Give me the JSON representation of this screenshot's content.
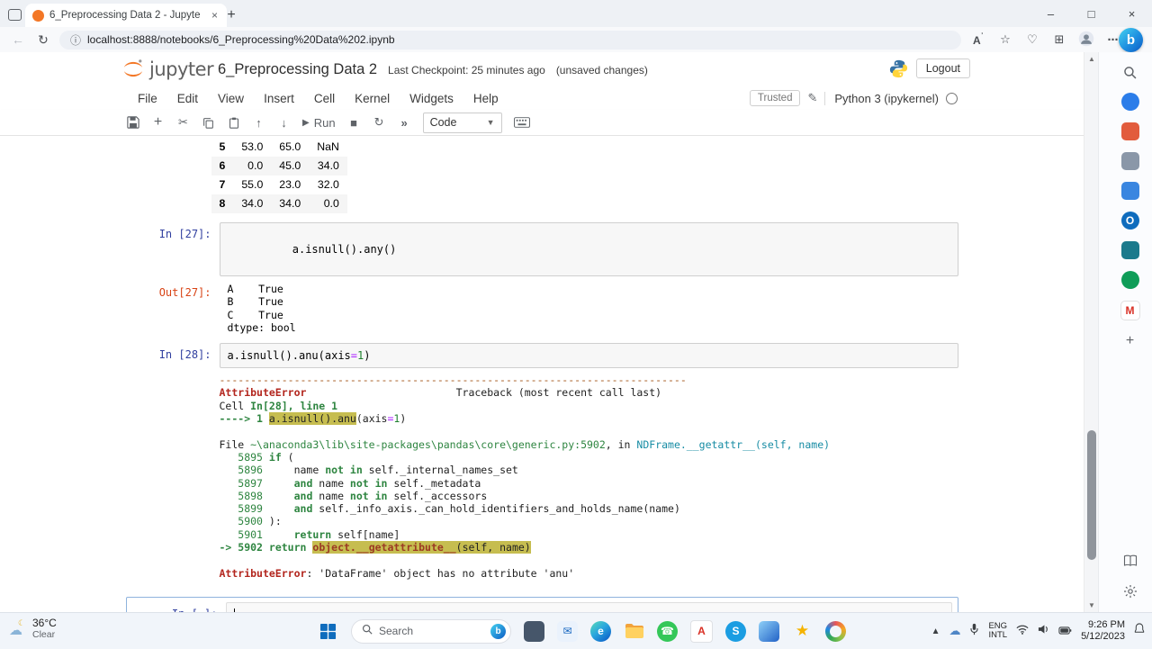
{
  "browser": {
    "tab_title": "6_Preprocessing Data 2 - Jupyte",
    "url": "localhost:8888/notebooks/6_Preprocessing%20Data%202.ipynb"
  },
  "jupyter": {
    "brand": "jupyter",
    "title": "6_Preprocessing Data 2",
    "checkpoint": "Last Checkpoint: 25 minutes ago",
    "unsaved": "(unsaved changes)",
    "logout_label": "Logout",
    "menu": [
      "File",
      "Edit",
      "View",
      "Insert",
      "Cell",
      "Kernel",
      "Widgets",
      "Help"
    ],
    "trusted_label": "Trusted",
    "kernel_label": "Python 3 (ipykernel)",
    "run_label": "Run",
    "cell_type_value": "Code",
    "brand_color": "#f37726"
  },
  "notebook": {
    "partial_table": {
      "rows": [
        {
          "index": "5",
          "values": [
            "53.0",
            "65.0",
            "NaN"
          ]
        },
        {
          "index": "6",
          "values": [
            "0.0",
            "45.0",
            "34.0"
          ]
        },
        {
          "index": "7",
          "values": [
            "55.0",
            "23.0",
            "32.0"
          ]
        },
        {
          "index": "8",
          "values": [
            "34.0",
            "34.0",
            "0.0"
          ]
        }
      ]
    },
    "in27": {
      "prompt": "In [27]:",
      "source": "a.isnull().any()"
    },
    "out27": {
      "prompt": "Out[27]:",
      "text": "A    True\nB    True\nC    True\ndtype: bool"
    },
    "in28": {
      "prompt": "In [28]:",
      "source_segments": [
        {
          "t": "a.isnull().anu(axis",
          "c": "plain"
        },
        {
          "t": "=",
          "c": "op"
        },
        {
          "t": "1",
          "c": "num"
        },
        {
          "t": ")",
          "c": "plain"
        }
      ]
    },
    "empty_cell": {
      "prompt": "In [ ]:"
    },
    "traceback": {
      "lines": [
        [
          {
            "t": "---------------------------------------------------------------------------",
            "c": "sep"
          }
        ],
        [
          {
            "t": "AttributeError",
            "c": "redb"
          },
          {
            "t": "                        Traceback (most recent call last)",
            "c": "plain"
          }
        ],
        [
          {
            "t": "Cell ",
            "c": "plain"
          },
          {
            "t": "In[28], line 1",
            "c": "greenb"
          }
        ],
        [
          {
            "t": "----> 1",
            "c": "greenb"
          },
          {
            "t": " ",
            "c": "plain"
          },
          {
            "t": "a.isnull().anu",
            "c": "hl"
          },
          {
            "t": "(axis",
            "c": "plain"
          },
          {
            "t": "=",
            "c": "op"
          },
          {
            "t": "1",
            "c": "num"
          },
          {
            "t": ")",
            "c": "plain"
          }
        ],
        [],
        [
          {
            "t": "File ",
            "c": "plain"
          },
          {
            "t": "~\\anaconda3\\lib\\site-packages\\pandas\\core\\generic.py:5902",
            "c": "green"
          },
          {
            "t": ", in ",
            "c": "plain"
          },
          {
            "t": "NDFrame.__getattr__",
            "c": "cyan"
          },
          {
            "t": "(self, name)",
            "c": "cyan"
          }
        ],
        [
          {
            "t": "   5895 ",
            "c": "green"
          },
          {
            "t": "if",
            "c": "greenb"
          },
          {
            "t": " (",
            "c": "plain"
          }
        ],
        [
          {
            "t": "   5896 ",
            "c": "green"
          },
          {
            "t": "    name ",
            "c": "plain"
          },
          {
            "t": "not in",
            "c": "greenb"
          },
          {
            "t": " self._internal_names_set",
            "c": "plain"
          }
        ],
        [
          {
            "t": "   5897 ",
            "c": "green"
          },
          {
            "t": "    ",
            "c": "plain"
          },
          {
            "t": "and",
            "c": "greenb"
          },
          {
            "t": " name ",
            "c": "plain"
          },
          {
            "t": "not in",
            "c": "greenb"
          },
          {
            "t": " self._metadata",
            "c": "plain"
          }
        ],
        [
          {
            "t": "   5898 ",
            "c": "green"
          },
          {
            "t": "    ",
            "c": "plain"
          },
          {
            "t": "and",
            "c": "greenb"
          },
          {
            "t": " name ",
            "c": "plain"
          },
          {
            "t": "not in",
            "c": "greenb"
          },
          {
            "t": " self._accessors",
            "c": "plain"
          }
        ],
        [
          {
            "t": "   5899 ",
            "c": "green"
          },
          {
            "t": "    ",
            "c": "plain"
          },
          {
            "t": "and",
            "c": "greenb"
          },
          {
            "t": " self._info_axis._can_hold_identifiers_and_holds_name(name)",
            "c": "plain"
          }
        ],
        [
          {
            "t": "   5900 ",
            "c": "green"
          },
          {
            "t": "):",
            "c": "plain"
          }
        ],
        [
          {
            "t": "   5901 ",
            "c": "green"
          },
          {
            "t": "    ",
            "c": "plain"
          },
          {
            "t": "return",
            "c": "greenb"
          },
          {
            "t": " self[name]",
            "c": "plain"
          }
        ],
        [
          {
            "t": "-> 5902",
            "c": "greenb"
          },
          {
            "t": " ",
            "c": "plain"
          },
          {
            "t": "return",
            "c": "greenb"
          },
          {
            "t": " ",
            "c": "plain"
          },
          {
            "t": "object.__getattribute__",
            "c": "hlred"
          },
          {
            "t": "(self, name)",
            "c": "hl"
          }
        ],
        [],
        [
          {
            "t": "AttributeError",
            "c": "redb"
          },
          {
            "t": ": 'DataFrame' object has no attribute 'anu'",
            "c": "plain"
          }
        ]
      ]
    }
  },
  "edge_sidebar": {
    "icons": [
      {
        "name": "sidebar-search-icon",
        "svg": "search",
        "plain": true
      },
      {
        "name": "sidebar-copilot-icon",
        "bg": "#2b7de9",
        "round": true
      },
      {
        "name": "sidebar-shopping-icon",
        "bg": "#e25c3d"
      },
      {
        "name": "sidebar-games-icon",
        "bg": "#8a97a8"
      },
      {
        "name": "sidebar-tools-icon",
        "bg": "#3a86e0"
      },
      {
        "name": "sidebar-outlook-icon",
        "bg": "#0f6cbd",
        "glyph": "O",
        "round": true
      },
      {
        "name": "sidebar-office-icon",
        "bg": "#1b7a8c"
      },
      {
        "name": "sidebar-planner-icon",
        "bg": "#0f9d58",
        "round": true
      },
      {
        "name": "sidebar-mail-m-icon",
        "bg": "#ffffff",
        "glyph": "M",
        "fg": "#d93025",
        "border": "1px solid #e0e0e0"
      },
      {
        "name": "sidebar-add-icon",
        "glyph": "+",
        "plain": true
      }
    ]
  },
  "taskbar": {
    "weather_temp": "36°C",
    "weather_desc": "Clear",
    "search_label": "Search",
    "apps": [
      {
        "name": "taskbar-window-app",
        "bg": "#46566a",
        "radius": "5px"
      },
      {
        "name": "taskbar-mail-app",
        "bg": "#eaf2fc",
        "glyph": "✉",
        "fg": "#1767c0",
        "radius": "5px"
      },
      {
        "name": "taskbar-edge-browser",
        "bg": "linear-gradient(140deg,#4fd0c0 10%,#2aa7de 45%,#0d62c9 90%)",
        "glyph": "e",
        "fg": "#ffffff",
        "radius": "50%"
      },
      {
        "name": "taskbar-file-explorer",
        "svg": "folder"
      },
      {
        "name": "taskbar-phone-green-app",
        "bg": "#34c759",
        "glyph": "☎",
        "fg": "#ffffff",
        "radius": "50%"
      },
      {
        "name": "taskbar-acrobat-app",
        "bg": "#ffffff",
        "glyph": "A",
        "fg": "#d93025",
        "radius": "4px",
        "border": "1px solid #dfe1e5"
      },
      {
        "name": "taskbar-skype-app",
        "bg": "#1b9de2",
        "glyph": "S",
        "fg": "#ffffff",
        "radius": "50%"
      },
      {
        "name": "taskbar-photos-app",
        "bg": "linear-gradient(135deg,#8fd0f8,#2262c6)",
        "radius": "5px"
      },
      {
        "name": "taskbar-star-app",
        "glyph": "★",
        "fg": "#f5b301",
        "plain": true
      },
      {
        "name": "taskbar-ring-app",
        "ring": true
      }
    ],
    "lang1": "ENG",
    "lang2": "INTL",
    "time": "9:26 PM",
    "date": "5/12/2023"
  }
}
